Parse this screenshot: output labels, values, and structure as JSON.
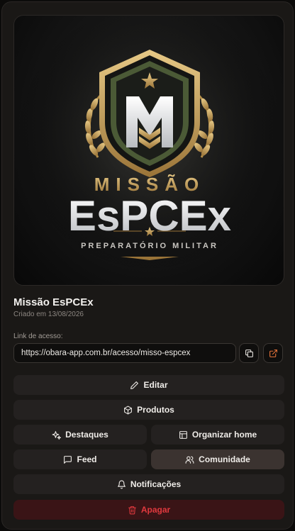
{
  "project": {
    "logo": {
      "line1": "MISSÃO",
      "line2": "EsPCEx",
      "tagline": "PREPARATÓRIO MILITAR"
    },
    "title": "Missão EsPCEx",
    "created": "Criado em 13/08/2026"
  },
  "access": {
    "label": "Link de acesso:",
    "url": "https://obara-app.com.br/acesso/misso-espcex"
  },
  "actions": {
    "edit": "Editar",
    "products": "Produtos",
    "highlights": "Destaques",
    "organize_home": "Organizar home",
    "feed": "Feed",
    "community": "Comunidade",
    "notifications": "Notificações",
    "delete": "Apagar"
  },
  "colors": {
    "accent": "#e8743a",
    "danger": "#e0393e",
    "gold": "#c9a45c",
    "olive": "#4b5a36"
  }
}
